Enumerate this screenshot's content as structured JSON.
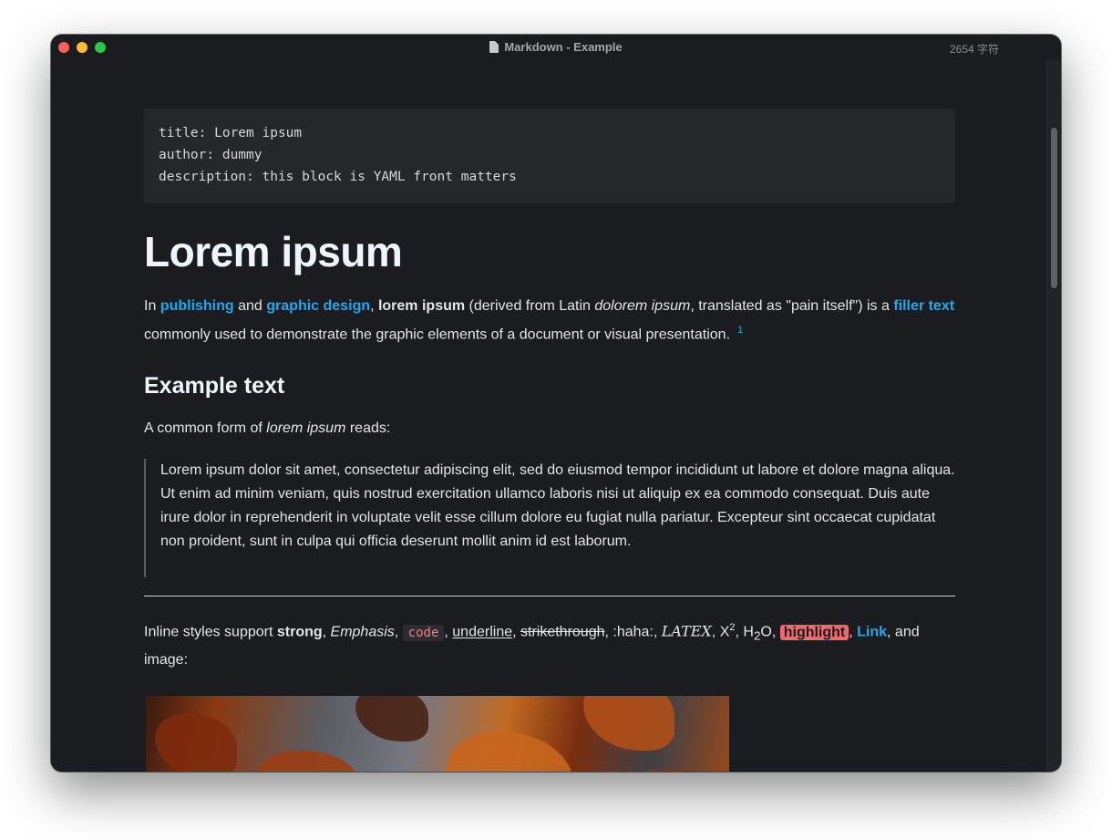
{
  "window": {
    "title": "Markdown - Example",
    "word_count": "2654 字符"
  },
  "front_matter": [
    "title: Lorem ipsum",
    "author: dummy",
    "description: this block is YAML front matters"
  ],
  "h1": "Lorem ipsum",
  "intro": {
    "t1": "In ",
    "link_publishing": "publishing",
    "t2": " and ",
    "link_graphic_design": "graphic design",
    "t3": ", ",
    "bold_lorem": "lorem ipsum",
    "t4": " (derived from Latin ",
    "italic_dolorem": "dolorem ipsum",
    "t5": ", translated as \"pain itself\") is a ",
    "link_filler_text": "filler text",
    "t6": " commonly used to demonstrate the graphic elements of a document or visual presentation.",
    "footnote": "1"
  },
  "h2": "Example text",
  "common_form": {
    "t1": "A common form of ",
    "italic": "lorem ipsum",
    "t2": " reads:"
  },
  "blockquote": "Lorem ipsum dolor sit amet, consectetur adipiscing elit, sed do eiusmod tempor incididunt ut labore et dolore magna aliqua. Ut enim ad minim veniam, quis nostrud exercitation ullamco laboris nisi ut aliquip ex ea commodo consequat. Duis aute irure dolor in reprehenderit in voluptate velit esse cillum dolore eu fugiat nulla pariatur. Excepteur sint occaecat cupidatat non proident, sunt in culpa qui officia deserunt mollit anim id est laborum.",
  "inline": {
    "t1": "Inline styles support ",
    "strong": "strong",
    "sep1": ", ",
    "emphasis": "Emphasis",
    "sep2": ", ",
    "code": "code",
    "sep3": ", ",
    "underline": "underline",
    "sep4": ", ",
    "strike": "strikethrough",
    "sep5": ", :haha:, ",
    "latex": "LATEX",
    "sep6": ", X",
    "sup": "2",
    "sep7": ", H",
    "sub": "2",
    "sep8": "O, ",
    "highlight": "highlight",
    "sep9": ", ",
    "link": "Link",
    "t2": ", and image:"
  },
  "colors": {
    "background": "#1b1c1f",
    "link": "#1ea8f0",
    "highlight": "#ef6a70",
    "code": "#f07f86"
  }
}
